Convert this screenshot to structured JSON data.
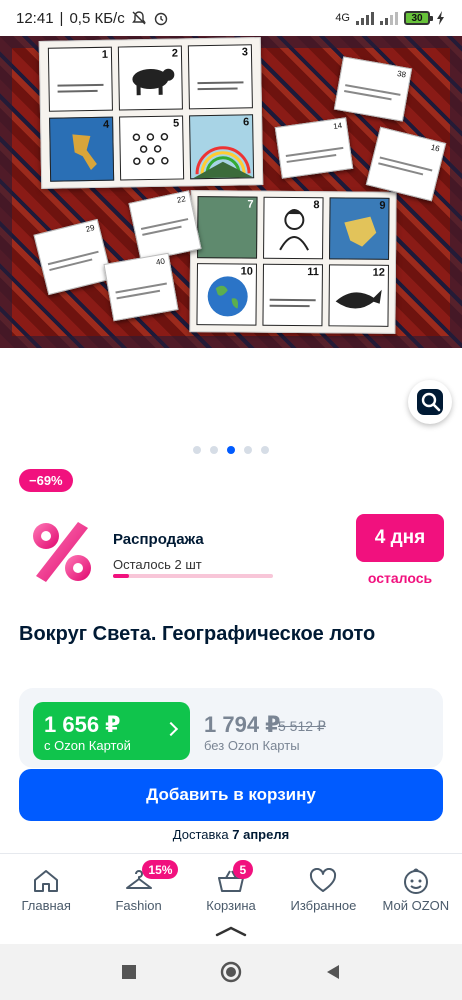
{
  "status_bar": {
    "time": "12:41",
    "speed": "0,5 КБ/с",
    "network": "4G",
    "battery": "30"
  },
  "gallery": {
    "board_numbers": [
      "1",
      "2",
      "3",
      "4",
      "5",
      "6",
      "7",
      "8",
      "9",
      "10",
      "11",
      "12"
    ],
    "loose_card_numbers": [
      "38",
      "14",
      "16",
      "22",
      "29",
      "40"
    ],
    "dots_total": 5,
    "active_dot": 3
  },
  "discount_badge": "−69%",
  "sale": {
    "title": "Распродажа",
    "remaining": "Осталось 2 шт",
    "remaining_fraction": 0.1,
    "days": "4 дня",
    "days_sub": "осталось"
  },
  "product": {
    "title": "Вокруг Света. Географическое лото"
  },
  "prices": {
    "ozon_price": "1 656 ₽",
    "ozon_label": "с Ozon Картой",
    "regular_price": "1 794 ₽",
    "old_price": "5 512 ₽",
    "regular_label": "без Ozon Карты"
  },
  "cart_button": "Добавить в корзину",
  "delivery": {
    "prefix": "Доставка",
    "date": "7 апреля"
  },
  "nav": {
    "items": [
      {
        "label": "Главная"
      },
      {
        "label": "Fashion",
        "badge": "15%"
      },
      {
        "label": "Корзина",
        "badge": "5"
      },
      {
        "label": "Избранное"
      },
      {
        "label": "Мой OZON"
      }
    ]
  },
  "colors": {
    "accent_blue": "#005bff",
    "accent_pink": "#f1117e",
    "ozon_green": "#10c44c"
  }
}
